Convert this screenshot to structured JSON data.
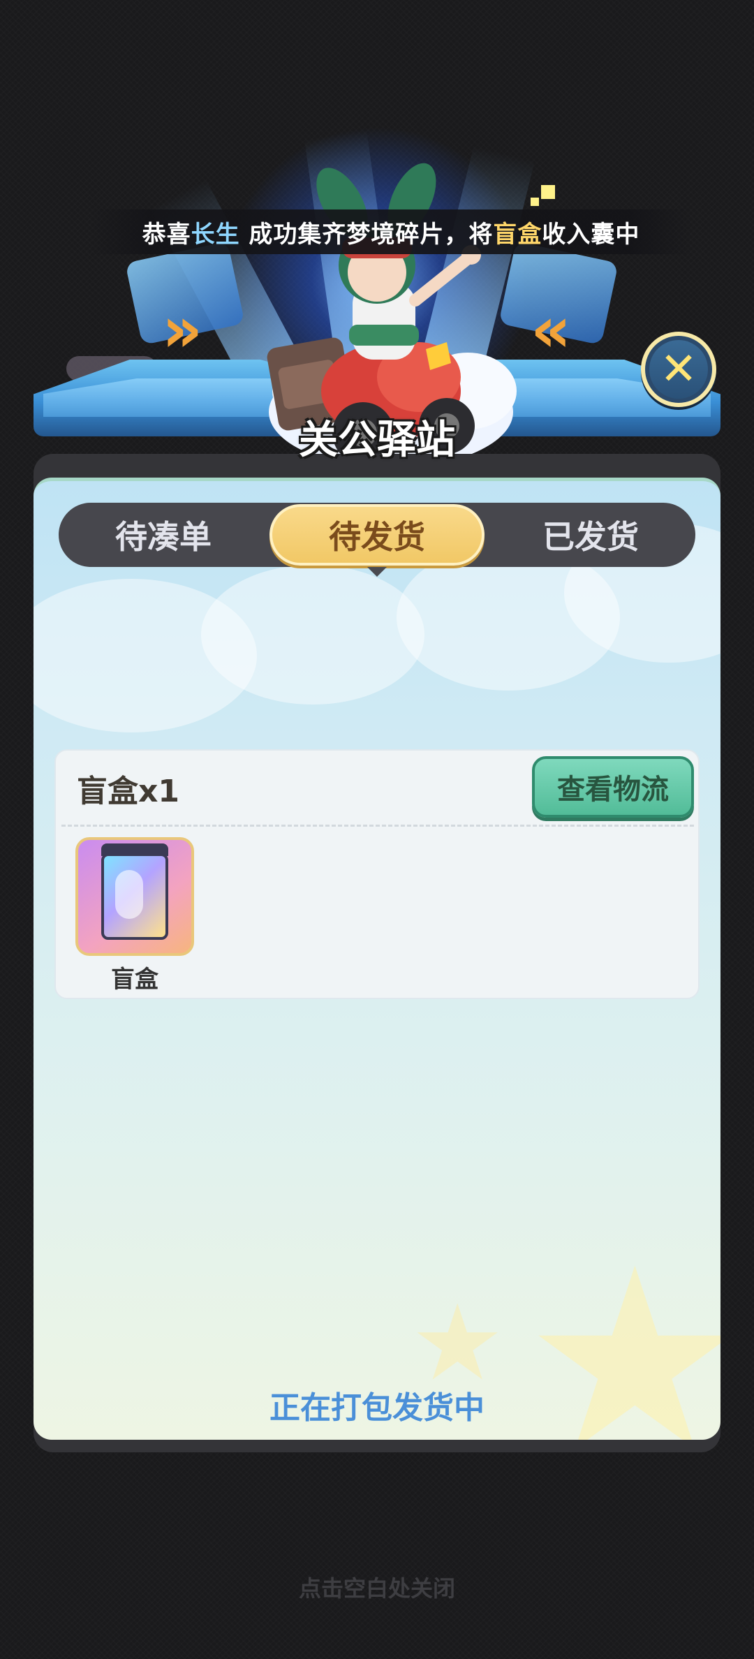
{
  "banner": {
    "prefix": "恭喜",
    "player_name": "长生",
    "middle": " 成功集齐梦境碎片，将",
    "item_name": "盲盒",
    "suffix": "收入囊中"
  },
  "title": "关公驿站",
  "tabs": [
    {
      "label": "待凑单",
      "active": false
    },
    {
      "label": "待发货",
      "active": true
    },
    {
      "label": "已发货",
      "active": false
    }
  ],
  "order": {
    "title": "盲盒x1",
    "logistics_button": "查看物流",
    "items": [
      {
        "label": "盲盒",
        "icon": "blind-box-icon"
      }
    ]
  },
  "status": "正在打包发货中",
  "dismiss_hint": "点击空白处关闭",
  "colors": {
    "accent_tab": "#f1c866",
    "logistics_button": "#52bc98",
    "status_text": "#4a8fd8",
    "player_name": "#8fd7ff",
    "item_name": "#ffd76a"
  }
}
